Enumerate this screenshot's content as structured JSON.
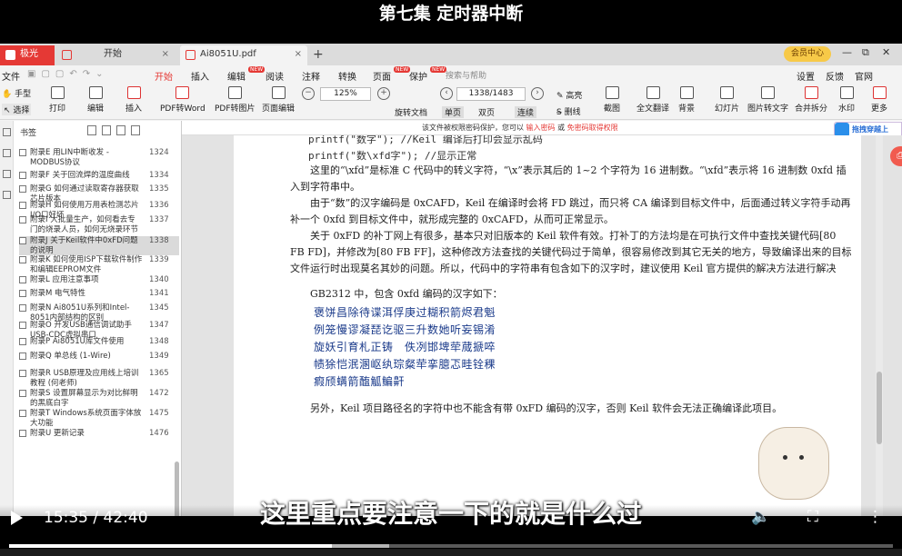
{
  "video_title": "第七集 定时器中断",
  "tabs": [
    {
      "label": "极光PDF",
      "color": "#e53935"
    },
    {
      "label": "开始",
      "color": "#e53935"
    },
    {
      "label": "Ai8051U.pdf",
      "color": "#e53935"
    }
  ],
  "tab_close": "×",
  "new_tab": "+",
  "vip_label": "会员中心",
  "window_controls": {
    "restore": "⧉",
    "minimize": "—",
    "maximize": "☐",
    "close": "✕"
  },
  "menu": {
    "file": "文件",
    "items": [
      {
        "label": "开始",
        "active": true,
        "badge": ""
      },
      {
        "label": "插入",
        "active": false,
        "badge": ""
      },
      {
        "label": "编辑",
        "active": false,
        "badge": "NEW"
      },
      {
        "label": "阅读",
        "active": false,
        "badge": ""
      },
      {
        "label": "注释",
        "active": false,
        "badge": ""
      },
      {
        "label": "转换",
        "active": false,
        "badge": ""
      },
      {
        "label": "页面",
        "active": false,
        "badge": "NEW"
      },
      {
        "label": "保护",
        "active": false,
        "badge": "NEW"
      }
    ],
    "search_placeholder": "搜索与帮助",
    "right": [
      "设置",
      "反馈",
      "官网"
    ]
  },
  "toolbar": {
    "hand": "手型",
    "select": "选择",
    "buttons": [
      "打印",
      "编辑",
      "插入",
      "PDF转Word",
      "PDF转图片",
      "页面编辑"
    ],
    "zoom": "125%",
    "zoom_out": "−",
    "zoom_in": "+",
    "rotate": "旋转文档",
    "page_input": "1338/1483",
    "prev": "‹",
    "next": "›",
    "view_modes": [
      "单页",
      "双页",
      "连续"
    ],
    "highlight": "高亮",
    "strikeout": "删线",
    "right_buttons": [
      "截图",
      "全文翻译",
      "背景",
      "幻灯片",
      "图片转文字",
      "合并拆分",
      "水印",
      "更多"
    ]
  },
  "sidebar": {
    "title": "书签",
    "bookmarks": [
      {
        "text": "附录E 用LIN中断收发 - MODBUS协议",
        "page": "1324",
        "selected": false
      },
      {
        "text": "附录F 关于回流焊的温度曲线",
        "page": "1334",
        "selected": false
      },
      {
        "text": "附录G 如何通过读取寄存器获取芯片版本",
        "page": "1335",
        "selected": false
      },
      {
        "text": "附录H 如何使用万用表检测芯片I/O口好坏",
        "page": "1336",
        "selected": false
      },
      {
        "text": "附录I 大批量生产，如何看去专门的烧录人员，如何无烧录环节",
        "page": "1337",
        "selected": false
      },
      {
        "text": "附录J 关于Keil软件中0xFD问题的说明",
        "page": "1338",
        "selected": true
      },
      {
        "text": "附录K 如何使用ISP下载软件制作和编辑EEPROM文件",
        "page": "1339",
        "selected": false
      },
      {
        "text": "附录L 应用注意事项",
        "page": "1340",
        "selected": false
      },
      {
        "text": "附录M 电气特性",
        "page": "1341",
        "selected": false
      },
      {
        "text": "附录N Ai8051U系列和Intel-8051内部结构的区别",
        "page": "1345",
        "selected": false
      },
      {
        "text": "附录O 开发USB通信调试助手USB-CDC虚拟串口",
        "page": "1347",
        "selected": false
      },
      {
        "text": "附录P Ai8051U库文件使用",
        "page": "1348",
        "selected": false
      },
      {
        "text": "附录Q 单总线 (1-Wire)",
        "page": "1349",
        "selected": false
      },
      {
        "text": "附录R USB原理及应用线上培训教程 (何老师)",
        "page": "1365",
        "selected": false
      },
      {
        "text": "附录S 设置屏幕显示为对比鲜明的黑底白字",
        "page": "1472",
        "selected": false
      },
      {
        "text": "附录T Windows系统页面字体放大功能",
        "page": "1475",
        "selected": false
      },
      {
        "text": "附录U 更新记录",
        "page": "1476",
        "selected": false
      }
    ]
  },
  "notice": {
    "text": "该文件被权限密码保护，您可以",
    "link1": "输入密码",
    "sep": "或",
    "link2": "免密码取得权限"
  },
  "right_panel": "拖拽穿越上",
  "document": {
    "code1": "printf(\"数字\");                   //Keil 编译后打印会显示乱码",
    "code2": "printf(\"数\\xfd字\");               //显示正常",
    "p1": "这里的“\\xfd”是标准 C 代码中的转义字符，“\\x”表示其后的 1~2 个字符为 16 进制数。“\\xfd”表示将 16 进制数 0xfd 插入到字符串中。",
    "p2": "由于“数”的汉字编码是 0xCAFD，Keil 在编译时会将 FD 跳过，而只将 CA 编译到目标文件中，后面通过转义字符手动再补一个 0xfd 到目标文件中，就形成完整的 0xCAFD，从而可正常显示。",
    "p3": "关于 0xFD 的补丁网上有很多，基本只对旧版本的 Keil 软件有效。打补丁的方法均是在可执行文件中查找关键代码[80 FB FD]，并修改为[80 FB FF]，这种修改方法查找的关键代码过于简单，很容易修改到其它无关的地方，导致编译出来的目标文件运行时出现莫名其妙的问题。所以，代码中的字符串有包含如下的汉字时，建议使用 Keil 官方提供的解决方法进行解决",
    "p4": "GB2312 中，包含 0xfd 编码的汉字如下：",
    "chars": [
      "褒饼昌除待谍洱俘庚过糊积箭烬君魁",
      "例笼慢谬凝琵讫驱三升数她听妄锡淆",
      "旋妖引育札正铸　佚冽邯埤荦蒇搋啐",
      "帻狳恺泯溷岖纨琮粲荦挛臆忑畦铨稞",
      "瘕颀螨箭醢觚鳊鼾"
    ],
    "p5": "另外，Keil 项目路径名的字符中也不能含有带 0xFD 编码的汉字，否则 Keil 软件会无法正确编译此项目。"
  },
  "float_btn": "⎙",
  "subtitle": "这里重点要注意一下的就是什么过",
  "player": {
    "current_time": "15:35",
    "separator": "/",
    "duration": "42:40",
    "progress": 0.365,
    "buffered": 0.43,
    "play": "▶",
    "volume": "🔈",
    "fullscreen": "⛶",
    "more": "⋮"
  }
}
